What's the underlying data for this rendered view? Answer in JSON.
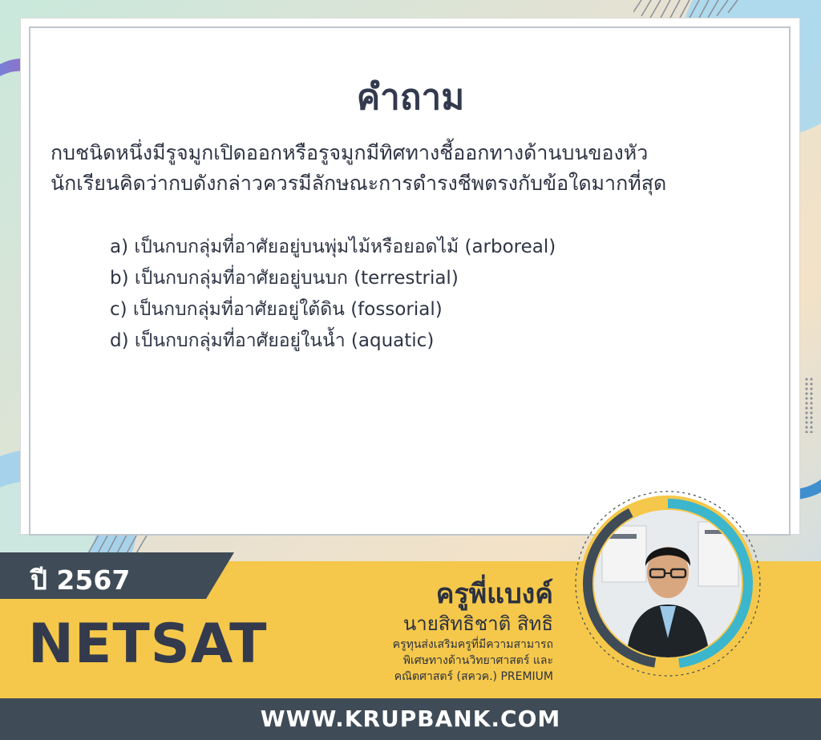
{
  "page": {
    "heading": "คำถาม",
    "question_lines": [
      "กบชนิดหนึ่งมีรูจมูกเปิดออกหรือรูจมูกมีทิศทางชี้ออกทางด้านบนของหัว",
      "นักเรียนคิดว่ากบดังกล่าวควรมีลักษณะการดำรงชีพตรงกับข้อใดมากที่สุด"
    ],
    "choices": [
      "a) เป็นกบกลุ่มที่อาศัยอยู่บนพุ่มไม้หรือยอดไม้ (arboreal)",
      "b) เป็นกบกลุ่มที่อาศัยอยู่บนบก (terrestrial)",
      "c) เป็นกบกลุ่มที่อาศัยอยู่ใต้ดิน (fossorial)",
      "d) เป็นกบกลุ่มที่อาศัยอยู่ในน้ำ (aquatic)"
    ]
  },
  "banner": {
    "year": "ปี 2567",
    "exam": "NETSAT",
    "teacher_nickname": "ครูพี่แบงค์",
    "teacher_fullname": "นายสิทธิชาติ สิทธิ",
    "teacher_credentials": [
      "ครูทุนส่งเสริมครูที่มีความสามารถ",
      "พิเศษทางด้านวิทยาศาสตร์ และ",
      "คณิตศาสตร์ (สควค.) PREMIUM"
    ],
    "website": "WWW.KRUPBANK.COM"
  },
  "colors": {
    "dark": "#3f4b56",
    "yellow": "#f5c84b",
    "text": "#2f3545",
    "accent_cyan": "#3bb6cc",
    "accent_pink": "#d9418f"
  }
}
